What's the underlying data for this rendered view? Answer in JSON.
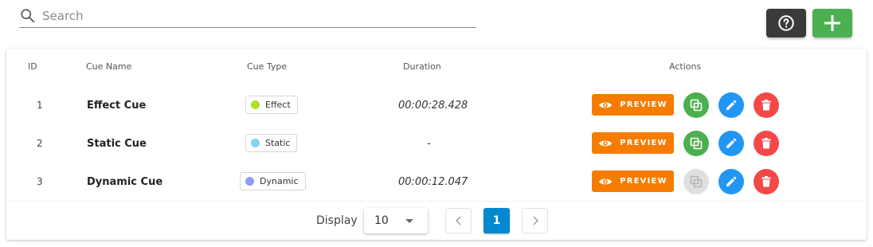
{
  "search": {
    "placeholder": "Search",
    "value": ""
  },
  "toolbar": {
    "help_icon": "help-circle-icon",
    "add_icon": "plus-icon"
  },
  "table": {
    "headers": {
      "id": "ID",
      "name": "Cue Name",
      "type": "Cue Type",
      "duration": "Duration",
      "actions": "Actions"
    },
    "rows": [
      {
        "id": "1",
        "name": "Effect Cue",
        "type": "Effect",
        "type_color": "#aee026",
        "duration": "00:00:28.428",
        "preview": "PREVIEW",
        "copy_enabled": true
      },
      {
        "id": "2",
        "name": "Static Cue",
        "type": "Static",
        "type_color": "#7fd3f7",
        "duration": "-",
        "preview": "PREVIEW",
        "copy_enabled": true
      },
      {
        "id": "3",
        "name": "Dynamic Cue",
        "type": "Dynamic",
        "type_color": "#8c9cff",
        "duration": "00:00:12.047",
        "preview": "PREVIEW",
        "copy_enabled": false
      }
    ]
  },
  "pagination": {
    "display_label": "Display",
    "page_size": "10",
    "current_page": "1"
  },
  "colors": {
    "preview": "#f57c00",
    "copy": "#4caf50",
    "edit": "#2196f3",
    "delete": "#f44848",
    "active_page": "#0288d1",
    "add": "#4caf50",
    "help": "#3a3a3a"
  }
}
